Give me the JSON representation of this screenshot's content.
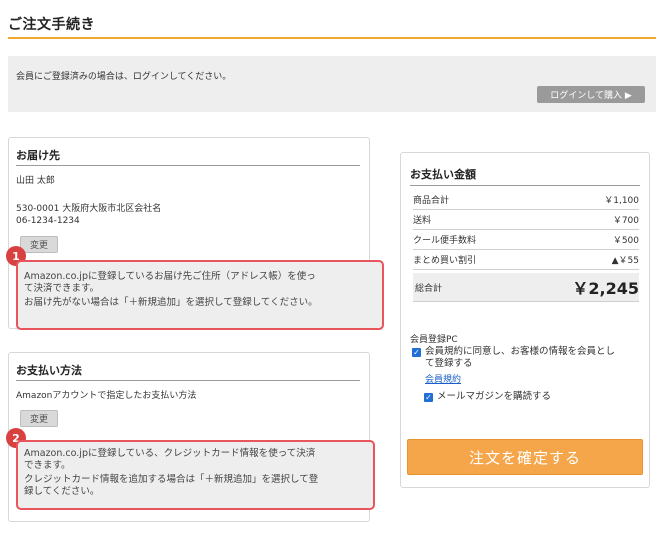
{
  "page": {
    "title": "ご注文手続き"
  },
  "login": {
    "message": "会員にご登録済みの場合は、ログインしてください。",
    "button": "ログインして購入 ▶"
  },
  "shipping": {
    "title": "お届け先",
    "name": "山田 太郎",
    "address": "530-0001 大阪府大阪市北区会社名",
    "phone": "06-1234-1234",
    "change_button": "変更",
    "callout_number": "1",
    "callout_lines": [
      "Amazon.co.jpに登録しているお届け先ご住所（アドレス帳）を使っ",
      "て決済できます。",
      "お届け先がない場合は「＋新規追加」を選択して登録してください。"
    ]
  },
  "payment_method": {
    "title": "お支払い方法",
    "description": "Amazonアカウントで指定したお支払い方法",
    "change_button": "変更",
    "callout_number": "2",
    "callout_lines": [
      "Amazon.co.jpに登録している、クレジットカード情報を使って決済",
      "できます。",
      "クレジットカード情報を追加する場合は「＋新規追加」を選択して登",
      "録してください。"
    ]
  },
  "payment_amount": {
    "title": "お支払い金額",
    "rows": [
      {
        "label": "商品合計",
        "value": "￥1,100"
      },
      {
        "label": "送料",
        "value": "￥700"
      },
      {
        "label": "クール便手数料",
        "value": "￥500"
      },
      {
        "label": "まとめ買い割引",
        "value": "▲￥55"
      }
    ],
    "total_label": "総合計",
    "total_value": "￥2,245"
  },
  "membership": {
    "title": "会員登録PC",
    "agree_lines": [
      "会員規約に同意し、お客様の情報を会員とし",
      "て登録する"
    ],
    "terms_link": "会員規約",
    "newsletter": "メールマガジンを購読する"
  },
  "confirm_button": "注文を確定する"
}
